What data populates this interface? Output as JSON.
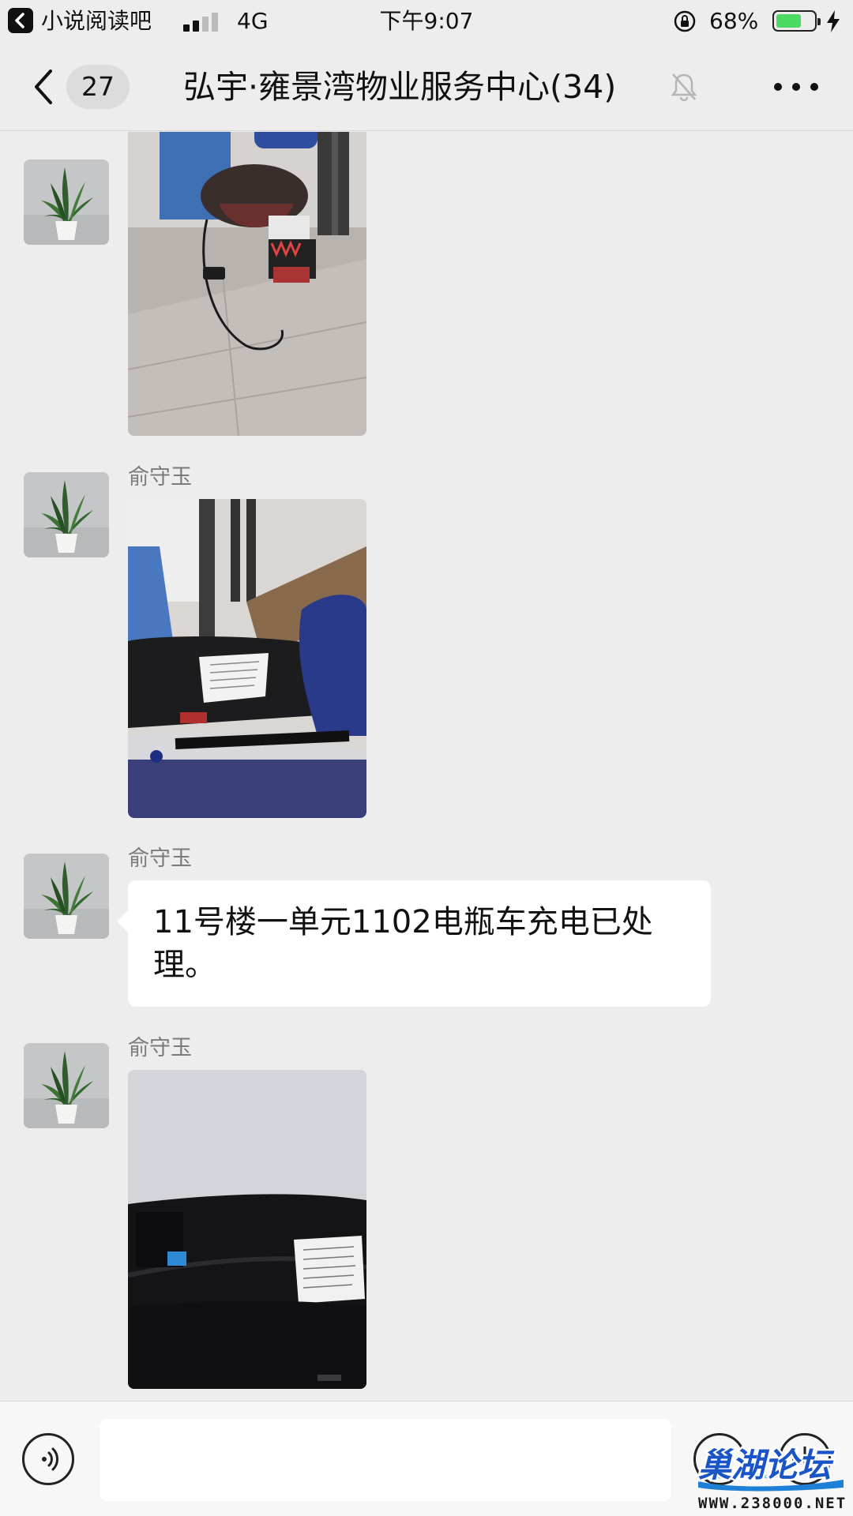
{
  "status_bar": {
    "back_app": "小说阅读吧",
    "network": "4G",
    "time": "下午9:07",
    "battery_percent": "68%",
    "battery_level": 0.68,
    "battery_color": "#4cd964"
  },
  "nav": {
    "unread_count": "27",
    "title": "弘宇·雍景湾物业服务中心(34)",
    "icons": [
      "chevron-left-icon",
      "bell-muted-icon",
      "more-icon"
    ]
  },
  "messages": [
    {
      "type": "image",
      "sender": "",
      "image_desc": "electric-scooter-charging-photo"
    },
    {
      "type": "image",
      "sender": "俞守玉",
      "image_desc": "scooter-seat-notice-photo"
    },
    {
      "type": "text",
      "sender": "俞守玉",
      "text": "11号楼一单元1102电瓶车充电已处理。"
    },
    {
      "type": "image",
      "sender": "俞守玉",
      "image_desc": "scooter-seat-notice-dark-photo"
    }
  ],
  "input_bar": {
    "placeholder": "",
    "icons": [
      "voice-icon",
      "emoji-icon",
      "plus-icon"
    ]
  },
  "watermark": {
    "logo_text": "巢湖论坛",
    "url": "WWW.238000.NET"
  }
}
